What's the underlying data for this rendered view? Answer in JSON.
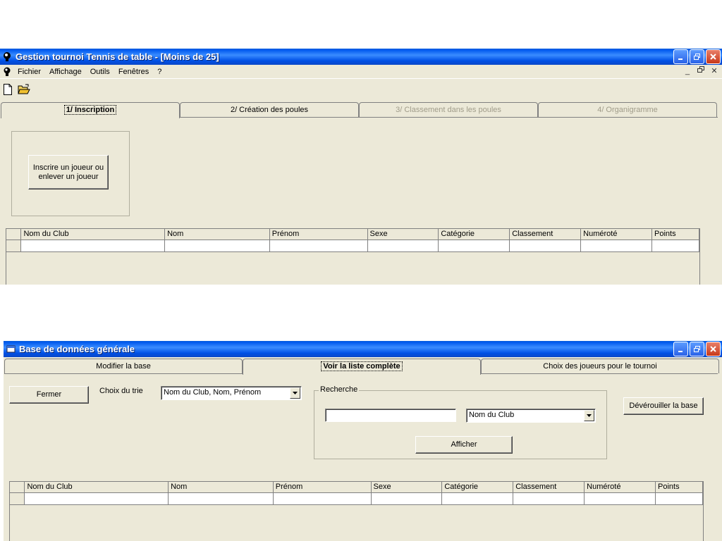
{
  "window1": {
    "title": "Gestion tournoi Tennis de table - [Moins de 25]",
    "menu": [
      "Fichier",
      "Affichage",
      "Outils",
      "Fenêtres",
      "?"
    ],
    "tabs": [
      {
        "label": "1/  Inscription",
        "state": "active"
      },
      {
        "label": "2/  Création des poules",
        "state": "enabled"
      },
      {
        "label": "3/  Classement dans les poules",
        "state": "disabled"
      },
      {
        "label": "4/  Organigramme",
        "state": "disabled"
      }
    ],
    "register_button": "Inscrire un joueur ou enlever un joueur",
    "grid_columns": [
      "Nom du Club",
      "Nom",
      "Prénom",
      "Sexe",
      "Catégorie",
      "Classement",
      "Numéroté",
      "Points"
    ]
  },
  "window2": {
    "title": "Base de données générale",
    "tabs": [
      {
        "label": "Modifier la base",
        "state": "enabled"
      },
      {
        "label": "Voir la liste complète",
        "state": "active"
      },
      {
        "label": "Choix des joueurs pour le tournoi",
        "state": "enabled"
      }
    ],
    "close_button": "Fermer",
    "sort_label": "Choix du trie",
    "sort_value": "Nom du Club, Nom, Prénom",
    "search_group_label": "Recherche",
    "search_value": "",
    "search_field_value": "Nom du Club",
    "show_button": "Afficher",
    "unlock_button": "Dévérouiller la base",
    "grid_columns": [
      "Nom du Club",
      "Nom",
      "Prénom",
      "Sexe",
      "Catégorie",
      "Classement",
      "Numéroté",
      "Points"
    ]
  },
  "colors": {
    "titlebar": "#0058ee",
    "face": "#ece9d8",
    "disabled_text": "#a09c8a"
  }
}
